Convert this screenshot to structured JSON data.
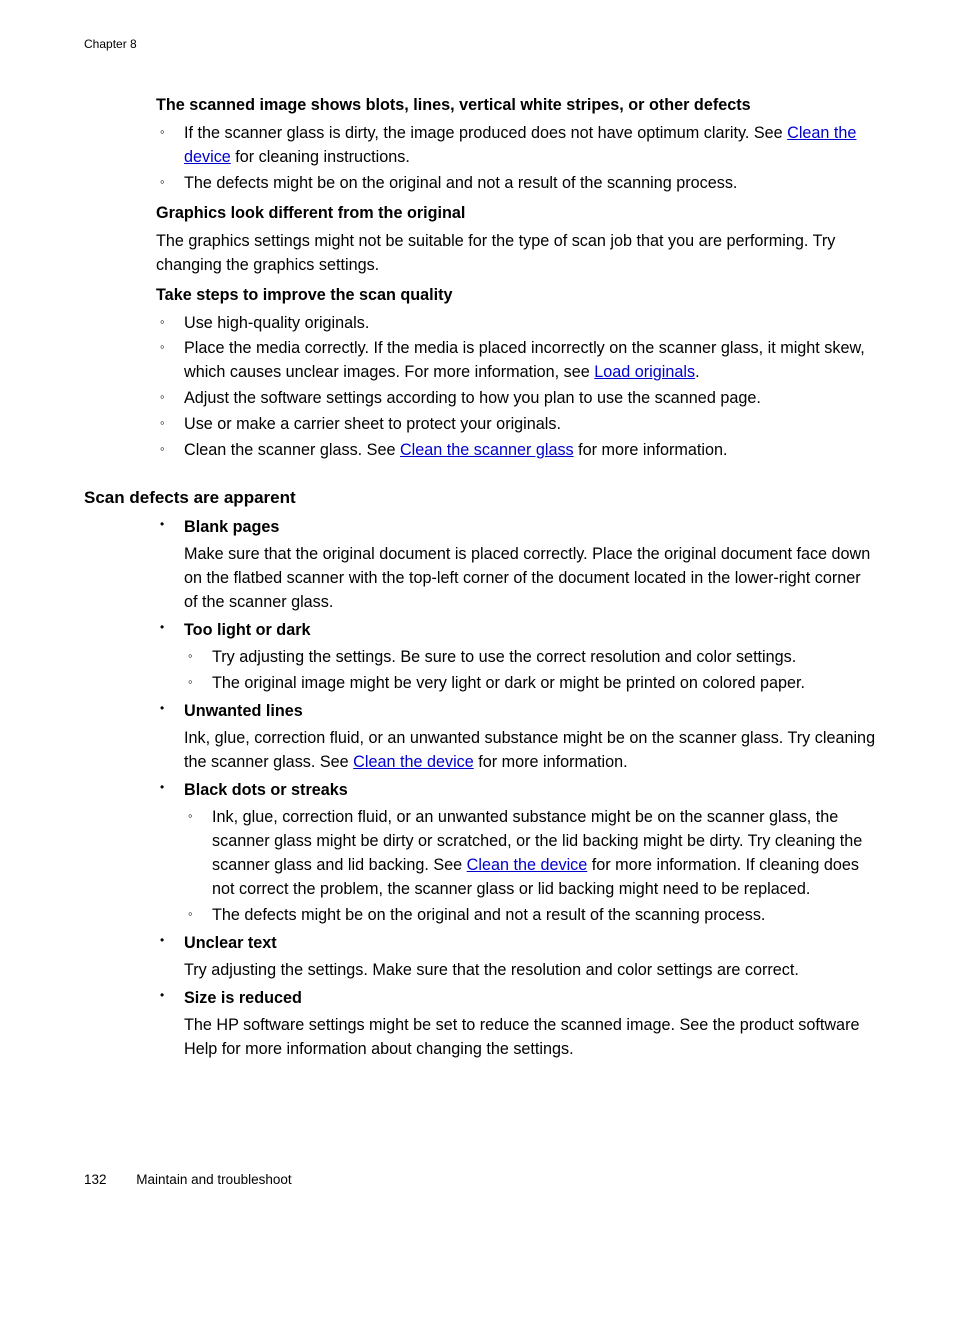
{
  "header": {
    "chapter": "Chapter 8"
  },
  "section1": {
    "title": "The scanned image shows blots, lines, vertical white stripes, or other defects",
    "item1_pre": "If the scanner glass is dirty, the image produced does not have optimum clarity. See ",
    "item1_link": "Clean the device",
    "item1_post": " for cleaning instructions.",
    "item2": "The defects might be on the original and not a result of the scanning process."
  },
  "section2": {
    "title": "Graphics look different from the original",
    "para": "The graphics settings might not be suitable for the type of scan job that you are performing. Try changing the graphics settings."
  },
  "section3": {
    "title": "Take steps to improve the scan quality",
    "item1": "Use high-quality originals.",
    "item2_pre": "Place the media correctly. If the media is placed incorrectly on the scanner glass, it might skew, which causes unclear images. For more information, see ",
    "item2_link": "Load originals",
    "item2_post": ".",
    "item3": "Adjust the software settings according to how you plan to use the scanned page.",
    "item4": "Use or make a carrier sheet to protect your originals.",
    "item5_pre": "Clean the scanner glass. See ",
    "item5_link": "Clean the scanner glass",
    "item5_post": " for more information."
  },
  "heading": "Scan defects are apparent",
  "defects": {
    "blank": {
      "title": "Blank pages",
      "para": "Make sure that the original document is placed correctly. Place the original document face down on the flatbed scanner with the top-left corner of the document located in the lower-right corner of the scanner glass."
    },
    "light": {
      "title": "Too light or dark",
      "item1": "Try adjusting the settings. Be sure to use the correct resolution and color settings.",
      "item2": "The original image might be very light or dark or might be printed on colored paper."
    },
    "unwanted": {
      "title": "Unwanted lines",
      "pre": "Ink, glue, correction fluid, or an unwanted substance might be on the scanner glass. Try cleaning the scanner glass. See ",
      "link": "Clean the device",
      "post": " for more information."
    },
    "black": {
      "title": "Black dots or streaks",
      "item1_pre": "Ink, glue, correction fluid, or an unwanted substance might be on the scanner glass, the scanner glass might be dirty or scratched, or the lid backing might be dirty. Try cleaning the scanner glass and lid backing. See ",
      "item1_link": "Clean the device",
      "item1_post": " for more information. If cleaning does not correct the problem, the scanner glass or lid backing might need to be replaced.",
      "item2": "The defects might be on the original and not a result of the scanning process."
    },
    "unclear": {
      "title": "Unclear text",
      "para": "Try adjusting the settings. Make sure that the resolution and color settings are correct."
    },
    "size": {
      "title": "Size is reduced",
      "para": "The HP software settings might be set to reduce the scanned image. See the product software Help for more information about changing the settings."
    }
  },
  "footer": {
    "page": "132",
    "title": "Maintain and troubleshoot"
  }
}
